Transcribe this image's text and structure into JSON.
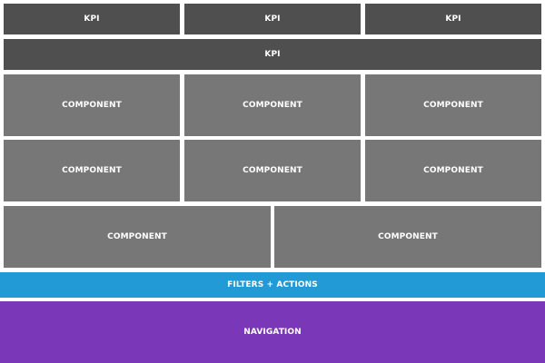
{
  "colors": {
    "kpi": "#4f4f4f",
    "component": "#777777",
    "filters": "#229ad6",
    "navigation": "#7a38b9"
  },
  "kpi_row_1": [
    "KPI",
    "KPI",
    "KPI"
  ],
  "kpi_row_2": [
    "KPI"
  ],
  "component_row_1": [
    "COMPONENT",
    "COMPONENT",
    "COMPONENT"
  ],
  "component_row_2": [
    "COMPONENT",
    "COMPONENT",
    "COMPONENT"
  ],
  "component_row_3": [
    "COMPONENT",
    "COMPONENT"
  ],
  "filters_label": "FILTERS + ACTIONS",
  "navigation_label": "NAVIGATION"
}
